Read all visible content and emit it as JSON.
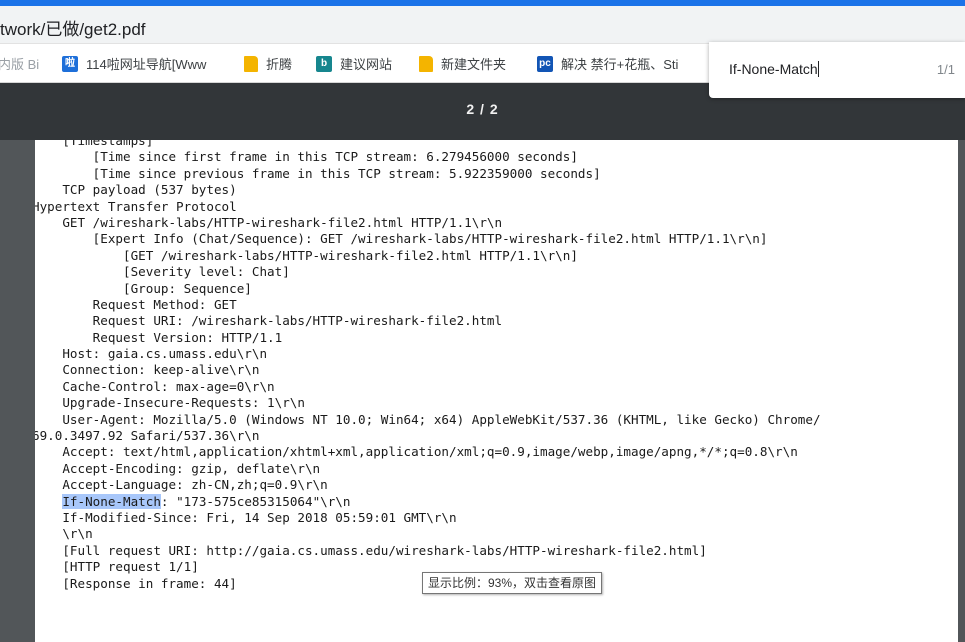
{
  "browser": {
    "url_text": "twork/已做/get2.pdf",
    "bookmarks": [
      {
        "label": "内版 Bi",
        "icon": "none"
      },
      {
        "label": "114啦网址导航[Www",
        "icon": "site-114-icon"
      },
      {
        "label": "折腾",
        "icon": "folder-icon"
      },
      {
        "label": "建议网站",
        "icon": "bing-icon"
      },
      {
        "label": "新建文件夹",
        "icon": "folder-icon"
      },
      {
        "label": "解决 禁行+花瓶、Sti",
        "icon": "pc-icon"
      }
    ]
  },
  "find": {
    "query": "If-None-Match",
    "count": "1/1"
  },
  "pdf": {
    "page_indicator": "2 / 2",
    "lines": [
      "    [Timestamps]",
      "        [Time since first frame in this TCP stream: 6.279456000 seconds]",
      "        [Time since previous frame in this TCP stream: 5.922359000 seconds]",
      "    TCP payload (537 bytes)",
      "Hypertext Transfer Protocol",
      "    GET /wireshark-labs/HTTP-wireshark-file2.html HTTP/1.1\\r\\n",
      "        [Expert Info (Chat/Sequence): GET /wireshark-labs/HTTP-wireshark-file2.html HTTP/1.1\\r\\n]",
      "            [GET /wireshark-labs/HTTP-wireshark-file2.html HTTP/1.1\\r\\n]",
      "            [Severity level: Chat]",
      "            [Group: Sequence]",
      "        Request Method: GET",
      "        Request URI: /wireshark-labs/HTTP-wireshark-file2.html",
      "        Request Version: HTTP/1.1",
      "    Host: gaia.cs.umass.edu\\r\\n",
      "    Connection: keep-alive\\r\\n",
      "    Cache-Control: max-age=0\\r\\n",
      "    Upgrade-Insecure-Requests: 1\\r\\n",
      "    User-Agent: Mozilla/5.0 (Windows NT 10.0; Win64; x64) AppleWebKit/537.36 (KHTML, like Gecko) Chrome/",
      "69.0.3497.92 Safari/537.36\\r\\n",
      "    Accept: text/html,application/xhtml+xml,application/xml;q=0.9,image/webp,image/apng,*/*;q=0.8\\r\\n",
      "    Accept-Encoding: gzip, deflate\\r\\n",
      "    Accept-Language: zh-CN,zh;q=0.9\\r\\n",
      "    ",
      "    If-Modified-Since: Fri, 14 Sep 2018 05:59:01 GMT\\r\\n",
      "    \\r\\n",
      "    [Full request URI: http://gaia.cs.umass.edu/wireshark-labs/HTTP-wireshark-file2.html]",
      "    [HTTP request 1/1]",
      "    [Response in frame: 44]"
    ],
    "highlight_line": {
      "indent": "    ",
      "match": "If-None-Match",
      "rest": ": \"173-575ce85315064\"\\r\\n"
    }
  },
  "tooltip": "显示比例：93%，双击查看原图"
}
